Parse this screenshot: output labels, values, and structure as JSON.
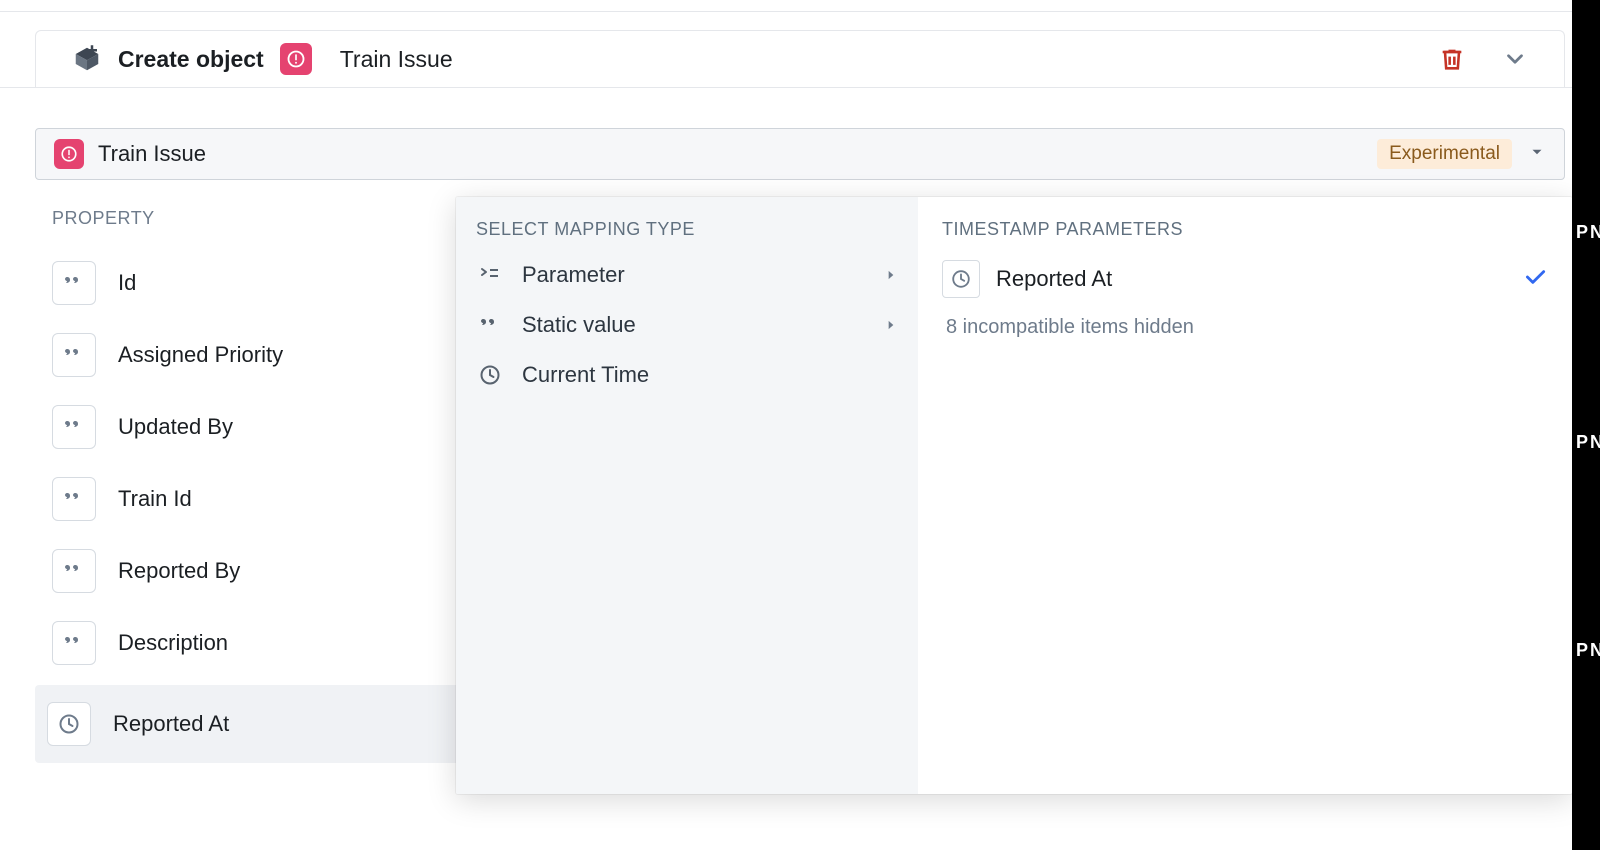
{
  "header": {
    "title": "Create object",
    "object_type": "Train Issue"
  },
  "object_banner": {
    "name": "Train Issue",
    "tag": "Experimental"
  },
  "properties": {
    "heading": "PROPERTY",
    "items": [
      {
        "label": "Id",
        "type": "string"
      },
      {
        "label": "Assigned Priority",
        "type": "string"
      },
      {
        "label": "Updated By",
        "type": "string"
      },
      {
        "label": "Train Id",
        "type": "string"
      },
      {
        "label": "Reported By",
        "type": "string"
      },
      {
        "label": "Description",
        "type": "string"
      },
      {
        "label": "Reported At",
        "type": "timestamp"
      }
    ]
  },
  "selected_property": {
    "label": "Reported At",
    "value_label": "Reported At"
  },
  "mapping_popover": {
    "left_heading": "SELECT MAPPING TYPE",
    "options": [
      {
        "label": "Parameter",
        "has_submenu": true,
        "icon": "parameter"
      },
      {
        "label": "Static value",
        "has_submenu": true,
        "icon": "quote"
      },
      {
        "label": "Current Time",
        "has_submenu": false,
        "icon": "clock"
      }
    ],
    "right_heading": "TIMESTAMP PARAMETERS",
    "params": [
      {
        "label": "Reported At",
        "selected": true
      }
    ],
    "hidden_note": "8 incompatible items hidden"
  },
  "right_strip": {
    "fragment": "PN"
  }
}
